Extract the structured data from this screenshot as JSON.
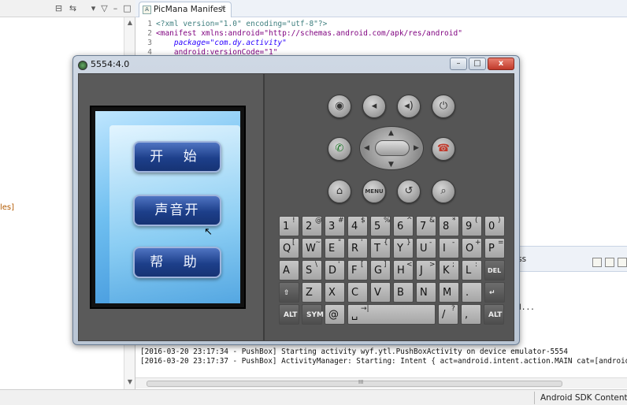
{
  "editor": {
    "tab_title": "PicMana Manifest",
    "lines": [
      {
        "num": "1",
        "text": "<?xml version=\"1.0\" encoding=\"utf-8\"?>"
      },
      {
        "num": "2",
        "text": "<manifest xmlns:android=\"http://schemas.android.com/apk/res/android\""
      },
      {
        "num": "3",
        "text": "    package=\"com.dy.activity\""
      },
      {
        "num": "4",
        "text": "    android:versionCode=\"1\""
      }
    ]
  },
  "left_panel": {
    "fragment_text": "les]"
  },
  "lower_panel": {
    "progress_tab": "gress",
    "console_dots": "d...",
    "log_lines": [
      "[2016-03-20 23:17:34 - PushBox] Starting activity wyf.ytl.PushBoxActivity on device emulator-5554",
      "[2016-03-20 23:17:37 - PushBox] ActivityManager: Starting: Intent { act=android.intent.action.MAIN cat=[android.in"
    ],
    "scroll_label": "III"
  },
  "statusbar": {
    "text": "Android SDK Content Lo"
  },
  "emulator": {
    "title": "5554:4.0",
    "window_buttons": [
      "–",
      "□",
      "x"
    ],
    "screen_buttons": [
      "开 始",
      "声音开",
      "帮 助"
    ],
    "hw_buttons": {
      "row1": [
        "camera-icon",
        "volume-down-icon",
        "volume-up-icon",
        "power-icon"
      ],
      "call": "call-icon",
      "end": "end-call-icon",
      "row3": [
        "home-icon",
        "MENU",
        "back-icon",
        "search-icon"
      ]
    },
    "keyboard": {
      "row1": [
        {
          "m": "1",
          "s": "!"
        },
        {
          "m": "2",
          "s": "@"
        },
        {
          "m": "3",
          "s": "#"
        },
        {
          "m": "4",
          "s": "$"
        },
        {
          "m": "5",
          "s": "%"
        },
        {
          "m": "6",
          "s": "^"
        },
        {
          "m": "7",
          "s": "&"
        },
        {
          "m": "8",
          "s": "*"
        },
        {
          "m": "9",
          "s": "("
        },
        {
          "m": "0",
          "s": ")"
        }
      ],
      "row2": [
        {
          "m": "Q",
          "s": "["
        },
        {
          "m": "W",
          "s": "~"
        },
        {
          "m": "E",
          "s": "\""
        },
        {
          "m": "R",
          "s": "'"
        },
        {
          "m": "T",
          "s": "{"
        },
        {
          "m": "Y",
          "s": "}"
        },
        {
          "m": "U",
          "s": "-"
        },
        {
          "m": "I",
          "s": "-"
        },
        {
          "m": "O",
          "s": "+"
        },
        {
          "m": "P",
          "s": "="
        }
      ],
      "row3": [
        {
          "m": "A",
          "s": ""
        },
        {
          "m": "S",
          "s": "\\"
        },
        {
          "m": "D",
          "s": "'"
        },
        {
          "m": "F",
          "s": "["
        },
        {
          "m": "G",
          "s": "]"
        },
        {
          "m": "H",
          "s": "<"
        },
        {
          "m": "J",
          "s": ">"
        },
        {
          "m": "K",
          "s": ";"
        },
        {
          "m": "L",
          "s": ":"
        },
        {
          "m": "DEL",
          "s": ""
        }
      ],
      "row4": [
        {
          "m": "⇧",
          "s": ""
        },
        {
          "m": "Z",
          "s": ""
        },
        {
          "m": "X",
          "s": ""
        },
        {
          "m": "C",
          "s": ""
        },
        {
          "m": "V",
          "s": ""
        },
        {
          "m": "B",
          "s": ""
        },
        {
          "m": "N",
          "s": ""
        },
        {
          "m": "M",
          "s": ""
        },
        {
          "m": ".",
          "s": ""
        },
        {
          "m": "↵",
          "s": ""
        }
      ],
      "row5": [
        {
          "m": "ALT",
          "s": ""
        },
        {
          "m": "SYM",
          "s": ""
        },
        {
          "m": "@",
          "s": ""
        },
        {
          "m": "␣",
          "s": "→|"
        },
        {
          "m": "/",
          "s": "?"
        },
        {
          "m": ",",
          "s": ""
        },
        {
          "m": "ALT",
          "s": ""
        }
      ]
    }
  },
  "colors": {
    "accent": "#1d3f8a",
    "emulator_bg": "#545454",
    "log_text": "#111111"
  }
}
